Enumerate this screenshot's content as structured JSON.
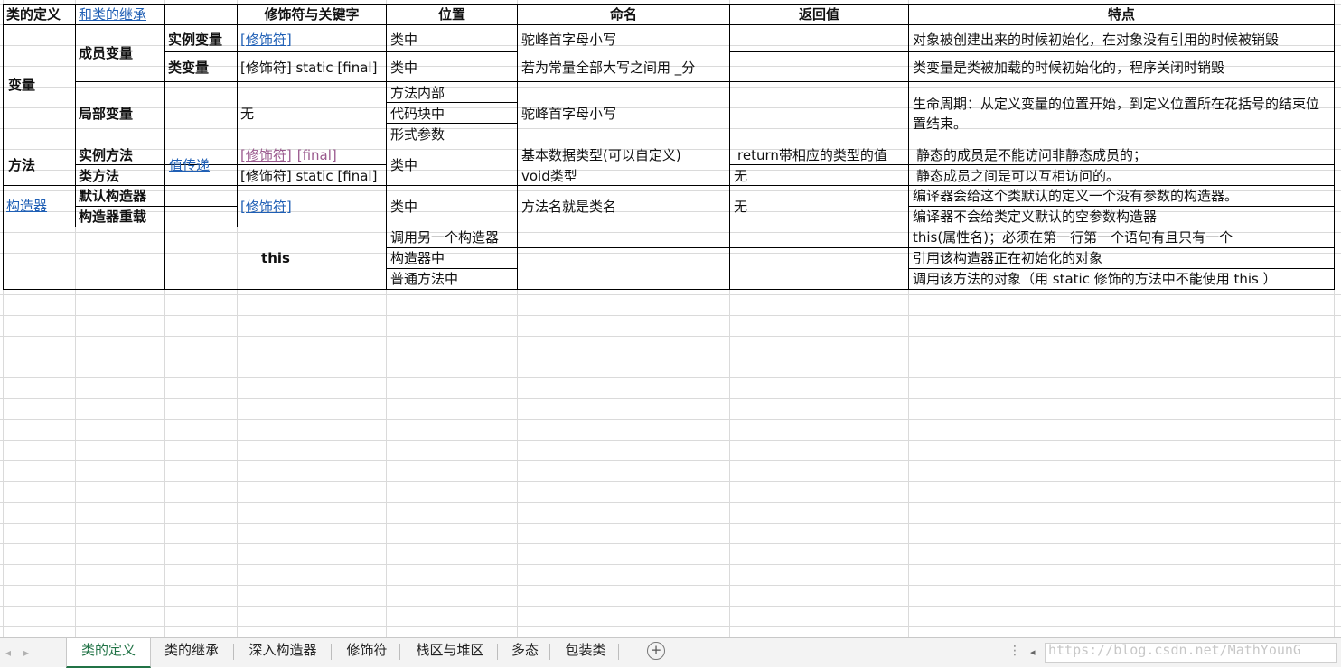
{
  "header": {
    "class_def": "类的定义",
    "class_inherit": "和类的继承",
    "modifiers": "修饰符与关键字",
    "location": "位置",
    "naming": "命名",
    "return_value": "返回值",
    "features": "特点"
  },
  "variable": {
    "group": "变量",
    "member": "成员变量",
    "local": "局部变量",
    "instance": {
      "label": "实例变量",
      "modifier": "[修饰符]",
      "location": "类中",
      "naming": "驼峰首字母小写",
      "feature": "对象被创建出来的时候初始化，在对象没有引用的时候被销毁"
    },
    "class_var": {
      "label": "类变量",
      "modifier": "[修饰符] static [final]",
      "location": "类中",
      "naming": "若为常量全部大写之间用 _分",
      "feature": "类变量是类被加载的时候初始化的，程序关闭时销毁"
    },
    "local_var": {
      "modifier": "无",
      "locations": [
        "方法内部",
        "代码块中",
        "形式参数"
      ],
      "naming": "驼峰首字母小写",
      "feature": "生命周期：从定义变量的位置开始，到定义位置所在花括号的结束位置结束。"
    }
  },
  "method": {
    "group": "方法",
    "pass": "值传递",
    "instance": {
      "label": "实例方法",
      "modifier_link": "[修饰符]",
      "modifier_final": "[final]",
      "naming": "基本数据类型(可以自定义)",
      "return": "return带相应的类型的值",
      "feature": "静态的成员是不能访问非静态成员的；"
    },
    "class_method": {
      "label": "类方法",
      "modifier": "[修饰符] static [final]",
      "naming": "void类型",
      "return": "无",
      "feature": "静态成员之间是可以互相访问的。"
    },
    "location": "类中"
  },
  "constructor": {
    "group": "构造器",
    "default_label": "默认构造器",
    "overload_label": "构造器重载",
    "modifier": "[修饰符]",
    "location": "类中",
    "naming": "方法名就是类名",
    "return": "无",
    "feature_default": "编译器会给这个类默认的定义一个没有参数的构造器。",
    "feature_overload": "编译器不会给类定义默认的空参数构造器"
  },
  "this_section": {
    "label": "this",
    "rows": [
      {
        "location": "调用另一个构造器",
        "feature": "this(属性名)；必须在第一行第一个语句有且只有一个"
      },
      {
        "location": "构造器中",
        "feature": "引用该构造器正在初始化的对象"
      },
      {
        "location": "普通方法中",
        "feature": "调用该方法的对象（用 static 修饰的方法中不能使用 this ）"
      }
    ]
  },
  "sheet_tabs": [
    "类的定义",
    "类的继承",
    "深入构造器",
    "修饰符",
    "栈区与堆区",
    "多态",
    "包装类"
  ],
  "active_tab": "类的定义",
  "nav": {
    "prev": "◂",
    "next": "▸",
    "add": "+",
    "more": "⋮",
    "scroll_left": "◂"
  },
  "watermark": "https://blog.csdn.net/MathYounG"
}
